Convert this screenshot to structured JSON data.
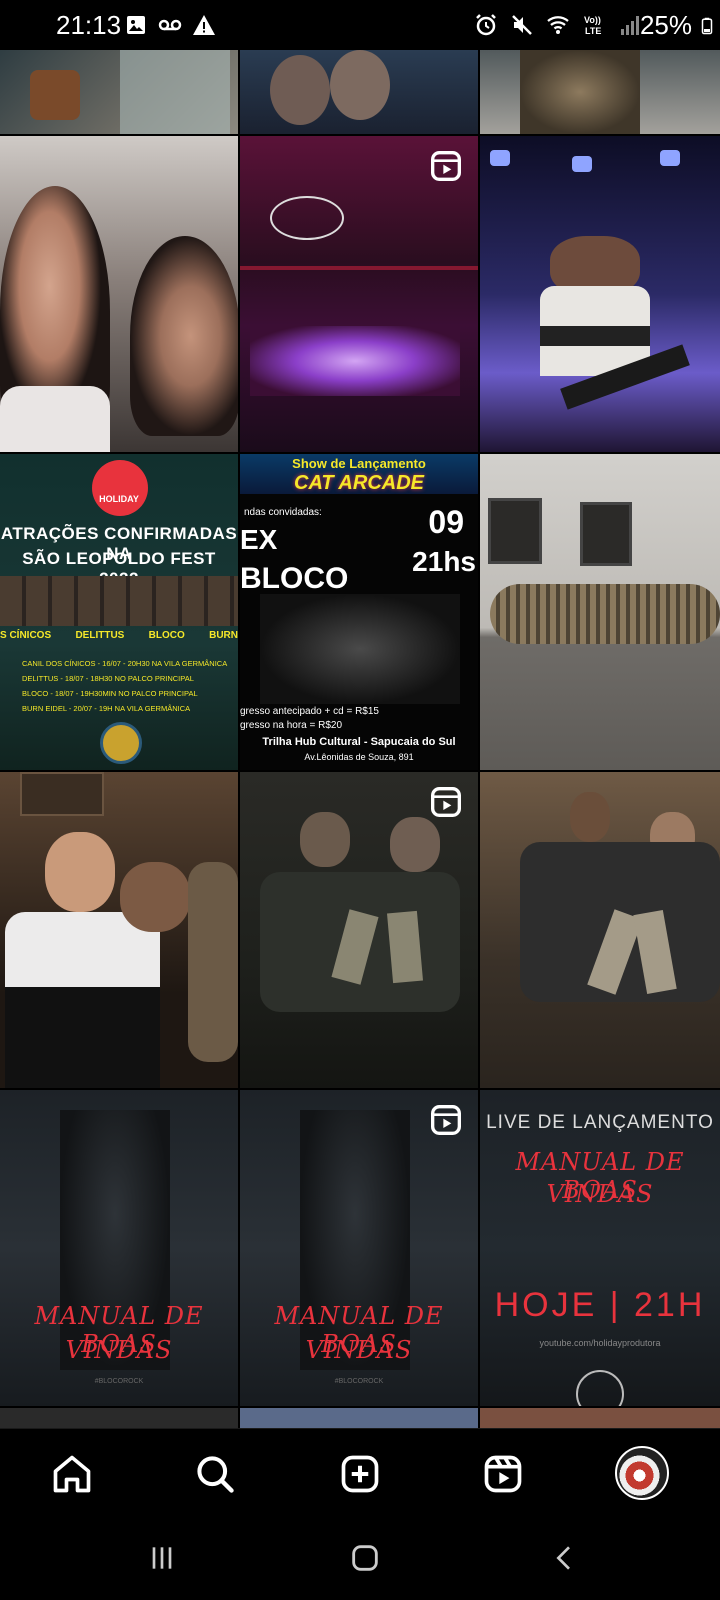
{
  "status_bar": {
    "time": "21:13",
    "battery_percent": "25%",
    "left_icons": [
      "gallery-icon",
      "voicemail-icon",
      "warning-icon"
    ],
    "right_icons": [
      "alarm-icon",
      "mute-icon",
      "wifi-icon",
      "volte-icon",
      "signal-icon",
      "battery-icon"
    ],
    "volte_label": "Vo))\nLTE"
  },
  "grid": {
    "tiles": [
      {
        "name": "post-tile-1",
        "reel": false,
        "desc_color": "#3b4a4e"
      },
      {
        "name": "post-tile-2",
        "reel": false,
        "desc_color": "#2d3a4a"
      },
      {
        "name": "post-tile-3",
        "reel": false,
        "desc_color": "#4a4642"
      },
      {
        "name": "post-tile-4",
        "reel": false,
        "desc_color": "#6b6563"
      },
      {
        "name": "post-tile-5",
        "reel": true,
        "desc_color": "#5a1238"
      },
      {
        "name": "post-tile-6",
        "reel": false,
        "desc_color": "#2a1d5a"
      },
      {
        "name": "post-tile-7",
        "reel": false,
        "desc_color": "#17322f"
      },
      {
        "name": "post-tile-8",
        "reel": false,
        "desc_color": "#0a0a0a"
      },
      {
        "name": "post-tile-9",
        "reel": false,
        "desc_color": "#8c8a86"
      },
      {
        "name": "post-tile-10",
        "reel": false,
        "desc_color": "#2e2218"
      },
      {
        "name": "post-tile-11",
        "reel": true,
        "desc_color": "#2a2a26"
      },
      {
        "name": "post-tile-12",
        "reel": false,
        "desc_color": "#3a3128"
      },
      {
        "name": "post-tile-13",
        "reel": false,
        "desc_color": "#1b2025"
      },
      {
        "name": "post-tile-14",
        "reel": true,
        "desc_color": "#1b2025"
      },
      {
        "name": "post-tile-15",
        "reel": false,
        "desc_color": "#1b2025"
      }
    ],
    "festival_poster": {
      "brand": "HOLIDAY",
      "headline_1": "ATRAÇÕES CONFIRMADAS NA",
      "headline_2": "SÃO LEOPOLDO FEST 2022",
      "bands": [
        "S CÍNICOS",
        "DELITTUS",
        "BLOCO",
        "BURN"
      ],
      "lines": [
        "CANIL DOS CÍNICOS - 16/07 - 20H30 NA VILA GERMÂNICA",
        "DELITTUS - 18/07 - 18H30 NO PALCO PRINCIPAL",
        "BLOCO - 18/07 - 19H30MIN NO PALCO PRINCIPAL",
        "BURN EIDEL - 20/07 - 19H NA VILA GERMÂNICA"
      ]
    },
    "show_poster": {
      "top": "Show de Lançamento",
      "title": "CAT ARCADE",
      "subtitle": "ndas convidadas:",
      "band_1": "EX",
      "band_2": "BLOCO",
      "date": "09",
      "time": "21hs",
      "price_1": "gresso antecipado + cd = R$15",
      "price_2": "gresso na hora = R$20",
      "venue": "Trilha Hub Cultural - Sapucaia do Sul",
      "address": "Av.Lêonidas de Souza, 891"
    },
    "manual_tile_1": {
      "line_1": "MANUAL DE BOAS",
      "line_2": "VINDAS",
      "tag": "#BLOCOROCK"
    },
    "manual_tile_2": {
      "line_1": "MANUAL DE BOAS",
      "line_2": "VINDAS",
      "tag": "#BLOCOROCK"
    },
    "live_tile": {
      "top": "LIVE DE LANÇAMENTO",
      "line_1": "MANUAL DE BOAS",
      "line_2": "VINDAS",
      "time": "HOJE | 21H",
      "url": "youtube.com/holidayprodutora"
    }
  },
  "bottom_nav": {
    "items": [
      "home-icon",
      "search-icon",
      "create-icon",
      "reels-icon",
      "profile-avatar"
    ]
  },
  "system_nav": {
    "items": [
      "recents-button",
      "home-button",
      "back-button"
    ]
  },
  "colors": {
    "accent_red": "#e8333d",
    "background": "#000000",
    "poster_green": "#17322f",
    "poster_yellow": "#f5e829"
  }
}
